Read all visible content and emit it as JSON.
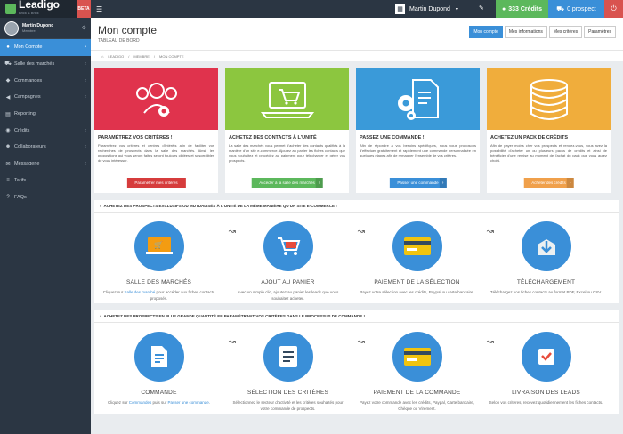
{
  "brand": {
    "logo": "Leadigo",
    "tagline": "Brick & Brick",
    "beta": "BETA"
  },
  "sidebar": {
    "user": {
      "name": "Martin Dupond",
      "role": "Membre"
    },
    "items": [
      {
        "label": "Mon Compte",
        "icon": "user-icon"
      },
      {
        "label": "Salle des marchés",
        "icon": "cart-icon"
      },
      {
        "label": "Commandes",
        "icon": "tag-icon"
      },
      {
        "label": "Campagnes",
        "icon": "megaphone-icon"
      },
      {
        "label": "Reporting",
        "icon": "chart-icon"
      },
      {
        "label": "Crédits",
        "icon": "coins-icon"
      },
      {
        "label": "Collaborateurs",
        "icon": "users-icon"
      },
      {
        "label": "Messagerie",
        "icon": "mail-icon"
      },
      {
        "label": "Tarifs",
        "icon": "list-icon"
      },
      {
        "label": "FAQs",
        "icon": "help-icon"
      }
    ]
  },
  "topbar": {
    "user_name": "Martin Dupond",
    "credits": "333 Crédits",
    "prospects": "0 prospect"
  },
  "page": {
    "title": "Mon compte",
    "subtitle": "TABLEAU DE BORD",
    "tabs": [
      "Mon compte",
      "Mes informations",
      "Mes critères",
      "Paramètres"
    ],
    "breadcrumb": [
      "LEADIGO",
      "MEMBRE",
      "MON COMPTE"
    ]
  },
  "cards": [
    {
      "color": "#e0334d",
      "title": "PARAMÉTREZ VOS CRITÈRES !",
      "text": "Paramétrez vos critères et centres d'intérêts afin de faciliter vos recherches de prospects dans la salle des marchés. Ainsi, les propositions qui vous seront faites seront toujours ciblées et susceptibles de vous intéresser.",
      "button": "Paramétrer mes critères",
      "btn_color": "#d63c3c"
    },
    {
      "color": "#8cc63f",
      "title": "ACHETEZ DES CONTACTS À L'UNITÉ",
      "text": "La salle des marchés vous permet d'acheter des contacts qualifiés à la manière d'un site e-commerce. Ajoutez au panier les fiches contacts que vous souhaitez et procédez au paiement pour télécharger et gérer vos prospects.",
      "button": "Accéder à la salle des marchés",
      "btn_color": "#5cb85c"
    },
    {
      "color": "#3a9ad9",
      "title": "PASSEZ UNE COMMANDE !",
      "text": "Afin de répondre à vos besoins spécifiques, nous vous proposons d'effectuer gratuitement et rapidement une commande personnalisée en quelques étapes afin de remagner l'ensemble de vos critères.",
      "button": "Passer une commande",
      "btn_color": "#3a8fd8"
    },
    {
      "color": "#f0ad3c",
      "title": "ACHETEZ UN PACK DE CRÉDITS",
      "text": "Afin de payer moins cher vos prospects et rendez-vous, vous avez la possibilité d'acheter un ou plusieurs packs de crédits et ainsi de bénéficier d'une remise au moment de l'achat du pack que vous aurez choisi.",
      "button": "Acheter des crédits",
      "btn_color": "#f0a04b"
    }
  ],
  "panel1": {
    "heading": "ACHETEZ DES PROSPECTS EXCLUSIFS OU MUTUALISÉS À L'UNITÉ DE LA MÊME MANIÈRE QU'UN SITE E-COMMERCE !",
    "steps": [
      {
        "title": "SALLE DES MARCHÉS",
        "pre": "Cliquez sur ",
        "link": "Salle des marché",
        "post": " pour accéder aux fiches contacts proposés.",
        "icon": "market-icon"
      },
      {
        "title": "AJOUT AU PANIER",
        "pre": "Avec un simple clic, ajoutez au panier les leads que vous souhaitez acheter.",
        "link": "",
        "post": "",
        "icon": "cart-icon"
      },
      {
        "title": "PAIEMENT DE LA SÉLECTION",
        "pre": "Payez votre sélection avec les crédits, Paypal ou carte bancaire.",
        "link": "",
        "post": "",
        "icon": "card-icon"
      },
      {
        "title": "TÉLÉCHARGEMENT",
        "pre": "Téléchargez vos fiches contacts au format PDF, Excel ou CSV.",
        "link": "",
        "post": "",
        "icon": "download-icon"
      }
    ]
  },
  "panel2": {
    "heading": "ACHETEZ DES PROSPECTS EN PLUS GRANDE QUANTITÉ EN PARAMÉTRANT VOS CRITÈRES DANS LE PROCESSUS DE COMMANDE !",
    "steps": [
      {
        "title": "COMMANDE",
        "pre": "Cliquez sur ",
        "link": "Commandes",
        "post": " puis sur ",
        "link2": "Passer une commande",
        "post2": ".",
        "icon": "order-icon"
      },
      {
        "title": "SÉLECTION DES CRITÈRES",
        "pre": "Sélectionnez le secteur d'activité et les critères souhaités pour votre commande de prospects.",
        "link": "",
        "post": "",
        "icon": "checklist-icon"
      },
      {
        "title": "PAIEMENT DE LA COMMANDE",
        "pre": "Payez votre commande avec les crédits, Paypal, Carte bancaire, Chèque ou Virement.",
        "link": "",
        "post": "",
        "icon": "card-icon"
      },
      {
        "title": "LIVRAISON DES LEADS",
        "pre": "Selon vos critères, recevez quotidiennement les fiches contacts.",
        "link": "",
        "post": "",
        "icon": "delivery-icon"
      }
    ]
  }
}
